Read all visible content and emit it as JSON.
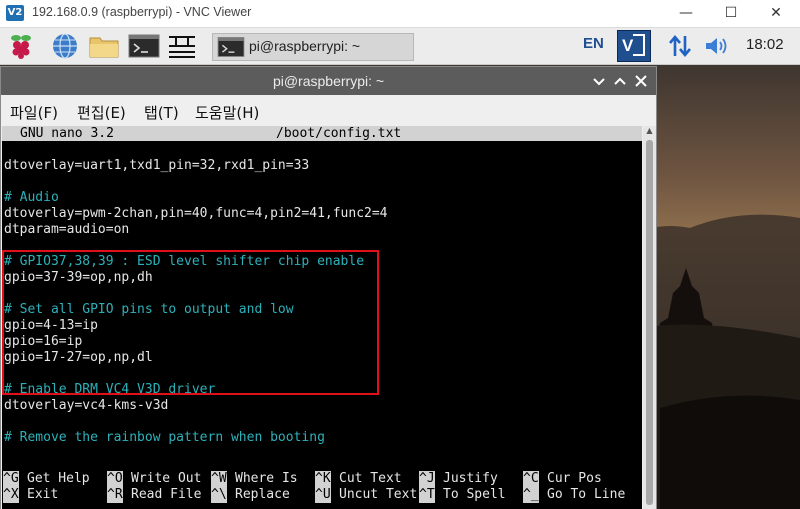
{
  "vnc": {
    "logo": "V2",
    "title": "192.168.0.9 (raspberrypi) - VNC Viewer",
    "minimize": "—",
    "maximize": "☐",
    "close": "✕"
  },
  "taskbar": {
    "task_label": "pi@raspberrypi: ~",
    "lang": "EN",
    "clock": "18:02",
    "icons": [
      "raspberry-menu-icon",
      "web-browser-icon",
      "file-manager-icon",
      "terminal-icon",
      "text-editor-icon",
      "vnc-server-icon",
      "network-icon",
      "volume-icon"
    ],
    "accent": "#1f4f8f"
  },
  "terminal": {
    "title": "pi@raspberrypi: ~",
    "menu": [
      "파일(F)",
      "편집(E)",
      "탭(T)",
      "도움말(H)"
    ],
    "nano": {
      "version": "GNU nano 3.2",
      "filename": "/boot/config.txt",
      "lines": [
        "dtoverlay=uart1,txd1_pin=32,rxd1_pin=33",
        "",
        "# Audio",
        "dtoverlay=pwm-2chan,pin=40,func=4,pin2=41,func2=4",
        "dtparam=audio=on",
        "",
        "# GPIO37,38,39 : ESD level shifter chip enable",
        "gpio=37-39=op,np,dh",
        "",
        "# Set all GPIO pins to output and low",
        "gpio=4-13=ip",
        "gpio=16=ip",
        "gpio=17-27=op,np,dl",
        "",
        "# Enable DRM VC4 V3D driver",
        "dtoverlay=vc4-kms-v3d",
        "",
        "# Remove the rainbow pattern when booting"
      ],
      "shortcuts_row1": [
        {
          "key": "^G",
          "label": "Get Help"
        },
        {
          "key": "^O",
          "label": "Write Out"
        },
        {
          "key": "^W",
          "label": "Where Is"
        },
        {
          "key": "^K",
          "label": "Cut Text"
        },
        {
          "key": "^J",
          "label": "Justify"
        },
        {
          "key": "^C",
          "label": "Cur Pos"
        }
      ],
      "shortcuts_row2": [
        {
          "key": "^X",
          "label": "Exit"
        },
        {
          "key": "^R",
          "label": "Read File"
        },
        {
          "key": "^\\",
          "label": "Replace"
        },
        {
          "key": "^U",
          "label": "Uncut Text"
        },
        {
          "key": "^T",
          "label": "To Spell"
        },
        {
          "key": "^_",
          "label": "Go To Line"
        }
      ],
      "comment_color": "#2cb1ba",
      "highlight_color": "#e0101a"
    }
  }
}
